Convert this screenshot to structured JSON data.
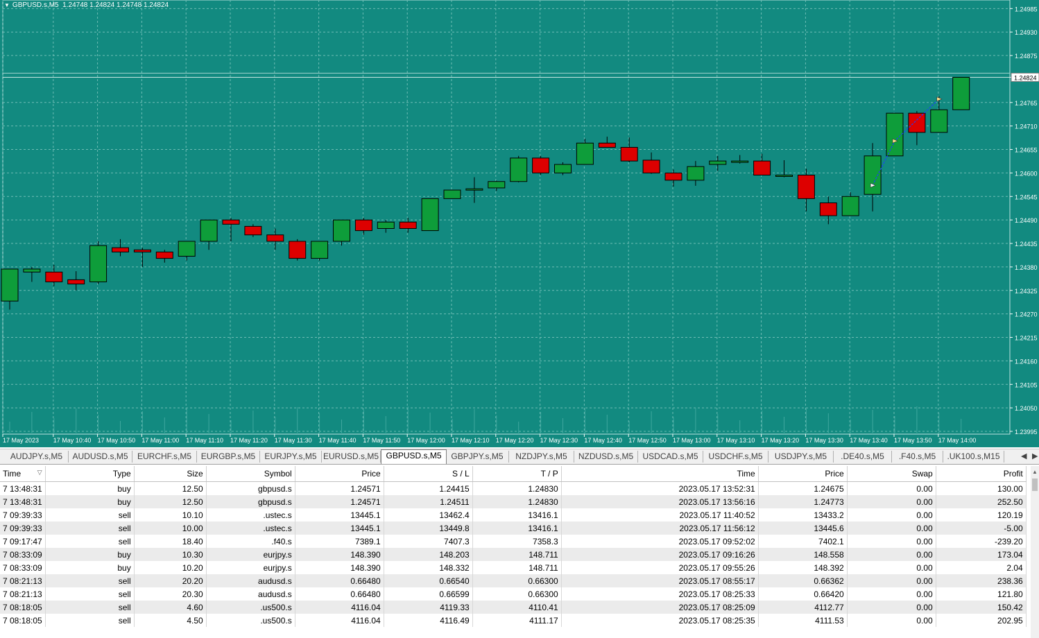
{
  "chart": {
    "symbol_header": "GBPUSD.s,M5",
    "ohlc_header": "1.24748 1.24824 1.24748 1.24824",
    "colors": {
      "background": "#128a80",
      "bull": "#0e9d3a",
      "bear": "#dd0000",
      "grid": "#6fbdb5",
      "text": "#ffffff"
    },
    "price_labels": [
      "1.24985",
      "1.24930",
      "1.24875",
      "1.24824",
      "1.24765",
      "1.24710",
      "1.24655",
      "1.24600",
      "1.24545",
      "1.24490",
      "1.24435",
      "1.24380",
      "1.24325",
      "1.24270",
      "1.24215",
      "1.24160",
      "1.24105",
      "1.24050",
      "1.23995"
    ],
    "current_price": "1.24824",
    "time_labels": [
      "17 May 2023",
      "17 May 10:40",
      "17 May 10:50",
      "17 May 11:00",
      "17 May 11:10",
      "17 May 11:20",
      "17 May 11:30",
      "17 May 11:40",
      "17 May 11:50",
      "17 May 12:00",
      "17 May 12:10",
      "17 May 12:20",
      "17 May 12:30",
      "17 May 12:40",
      "17 May 12:50",
      "17 May 13:00",
      "17 May 13:10",
      "17 May 13:20",
      "17 May 13:30",
      "17 May 13:40",
      "17 May 13:50",
      "17 May 14:00"
    ]
  },
  "chart_data": {
    "type": "candlestick",
    "ylim": [
      1.23995,
      1.25005
    ],
    "candles": [
      {
        "o": 1.243,
        "h": 1.2437,
        "l": 1.2428,
        "c": 1.24375
      },
      {
        "o": 1.24368,
        "h": 1.2438,
        "l": 1.24345,
        "c": 1.24375
      },
      {
        "o": 1.24368,
        "h": 1.24385,
        "l": 1.24335,
        "c": 1.24345
      },
      {
        "o": 1.2435,
        "h": 1.2437,
        "l": 1.24325,
        "c": 1.2434
      },
      {
        "o": 1.24345,
        "h": 1.2444,
        "l": 1.2434,
        "c": 1.2443
      },
      {
        "o": 1.24425,
        "h": 1.24445,
        "l": 1.24405,
        "c": 1.24415
      },
      {
        "o": 1.2442,
        "h": 1.24425,
        "l": 1.2438,
        "c": 1.24415
      },
      {
        "o": 1.24415,
        "h": 1.2442,
        "l": 1.2439,
        "c": 1.244
      },
      {
        "o": 1.24405,
        "h": 1.2444,
        "l": 1.24395,
        "c": 1.2444
      },
      {
        "o": 1.2444,
        "h": 1.2449,
        "l": 1.2442,
        "c": 1.2449
      },
      {
        "o": 1.2449,
        "h": 1.24495,
        "l": 1.2444,
        "c": 1.2448
      },
      {
        "o": 1.24475,
        "h": 1.2448,
        "l": 1.2445,
        "c": 1.24455
      },
      {
        "o": 1.24455,
        "h": 1.2447,
        "l": 1.2442,
        "c": 1.2444
      },
      {
        "o": 1.2444,
        "h": 1.24445,
        "l": 1.24395,
        "c": 1.244
      },
      {
        "o": 1.244,
        "h": 1.2444,
        "l": 1.24395,
        "c": 1.2444
      },
      {
        "o": 1.2444,
        "h": 1.2449,
        "l": 1.2443,
        "c": 1.2449
      },
      {
        "o": 1.2449,
        "h": 1.24495,
        "l": 1.24455,
        "c": 1.24465
      },
      {
        "o": 1.2447,
        "h": 1.2449,
        "l": 1.2446,
        "c": 1.24485
      },
      {
        "o": 1.24485,
        "h": 1.24495,
        "l": 1.2446,
        "c": 1.2447
      },
      {
        "o": 1.24465,
        "h": 1.24535,
        "l": 1.24465,
        "c": 1.2454
      },
      {
        "o": 1.2454,
        "h": 1.2456,
        "l": 1.2454,
        "c": 1.2456
      },
      {
        "o": 1.2456,
        "h": 1.2459,
        "l": 1.2453,
        "c": 1.24563
      },
      {
        "o": 1.24565,
        "h": 1.24582,
        "l": 1.24558,
        "c": 1.2458
      },
      {
        "o": 1.2458,
        "h": 1.2464,
        "l": 1.24578,
        "c": 1.24635
      },
      {
        "o": 1.24635,
        "h": 1.2464,
        "l": 1.24595,
        "c": 1.246
      },
      {
        "o": 1.246,
        "h": 1.24625,
        "l": 1.24595,
        "c": 1.2462
      },
      {
        "o": 1.2462,
        "h": 1.2468,
        "l": 1.2462,
        "c": 1.2467
      },
      {
        "o": 1.2467,
        "h": 1.24685,
        "l": 1.2466,
        "c": 1.2466
      },
      {
        "o": 1.2466,
        "h": 1.24683,
        "l": 1.24625,
        "c": 1.24628
      },
      {
        "o": 1.2463,
        "h": 1.24648,
        "l": 1.24598,
        "c": 1.246
      },
      {
        "o": 1.246,
        "h": 1.24608,
        "l": 1.24568,
        "c": 1.24583
      },
      {
        "o": 1.24583,
        "h": 1.24628,
        "l": 1.2457,
        "c": 1.24615
      },
      {
        "o": 1.2462,
        "h": 1.2464,
        "l": 1.24605,
        "c": 1.24628
      },
      {
        "o": 1.24628,
        "h": 1.24642,
        "l": 1.24622,
        "c": 1.24628
      },
      {
        "o": 1.24628,
        "h": 1.24645,
        "l": 1.246,
        "c": 1.24595
      },
      {
        "o": 1.24595,
        "h": 1.2463,
        "l": 1.2459,
        "c": 1.24595
      },
      {
        "o": 1.24595,
        "h": 1.2461,
        "l": 1.2451,
        "c": 1.2454
      },
      {
        "o": 1.2453,
        "h": 1.24545,
        "l": 1.2448,
        "c": 1.245
      },
      {
        "o": 1.245,
        "h": 1.24555,
        "l": 1.245,
        "c": 1.24545
      },
      {
        "o": 1.2455,
        "h": 1.2467,
        "l": 1.2451,
        "c": 1.2464
      },
      {
        "o": 1.2464,
        "h": 1.2474,
        "l": 1.2464,
        "c": 1.2474
      },
      {
        "o": 1.2474,
        "h": 1.24745,
        "l": 1.24665,
        "c": 1.24695
      },
      {
        "o": 1.24695,
        "h": 1.2478,
        "l": 1.24695,
        "c": 1.24748
      },
      {
        "o": 1.24748,
        "h": 1.24824,
        "l": 1.24748,
        "c": 1.24824
      }
    ],
    "trade_markers": [
      {
        "candle": 39,
        "price": 1.24571,
        "label": "open"
      },
      {
        "candle": 40,
        "price": 1.24675,
        "label": "close"
      },
      {
        "candle": 42,
        "price": 1.24773,
        "label": "close"
      }
    ]
  },
  "tabs": {
    "items": [
      "AUDJPY.s,M5",
      "AUDUSD.s,M5",
      "EURCHF.s,M5",
      "EURGBP.s,M5",
      "EURJPY.s,M5",
      "EURUSD.s,M5",
      "GBPUSD.s,M5",
      "GBPJPY.s,M5",
      "NZDJPY.s,M5",
      "NZDUSD.s,M5",
      "USDCAD.s,M5",
      "USDCHF.s,M5",
      "USDJPY.s,M5",
      ".DE40.s,M5",
      ".F40.s,M5",
      ".UK100.s,M15"
    ],
    "active_index": 6,
    "left_arrow": "◀",
    "right_arrow": "▶"
  },
  "history": {
    "columns": [
      "Time",
      "Type",
      "Size",
      "Symbol",
      "Price",
      "S / L",
      "T / P",
      "Time",
      "Price",
      "Swap",
      "Profit"
    ],
    "sort_indicator": "▽",
    "rows": [
      [
        "7 13:48:31",
        "buy",
        "12.50",
        "gbpusd.s",
        "1.24571",
        "1.24415",
        "1.24830",
        "2023.05.17 13:52:31",
        "1.24675",
        "0.00",
        "130.00"
      ],
      [
        "7 13:48:31",
        "buy",
        "12.50",
        "gbpusd.s",
        "1.24571",
        "1.24511",
        "1.24830",
        "2023.05.17 13:56:16",
        "1.24773",
        "0.00",
        "252.50"
      ],
      [
        "7 09:39:33",
        "sell",
        "10.10",
        ".ustec.s",
        "13445.1",
        "13462.4",
        "13416.1",
        "2023.05.17 11:40:52",
        "13433.2",
        "0.00",
        "120.19"
      ],
      [
        "7 09:39:33",
        "sell",
        "10.00",
        ".ustec.s",
        "13445.1",
        "13449.8",
        "13416.1",
        "2023.05.17 11:56:12",
        "13445.6",
        "0.00",
        "-5.00"
      ],
      [
        "7 09:17:47",
        "sell",
        "18.40",
        ".f40.s",
        "7389.1",
        "7407.3",
        "7358.3",
        "2023.05.17 09:52:02",
        "7402.1",
        "0.00",
        "-239.20"
      ],
      [
        "7 08:33:09",
        "buy",
        "10.30",
        "eurjpy.s",
        "148.390",
        "148.203",
        "148.711",
        "2023.05.17 09:16:26",
        "148.558",
        "0.00",
        "173.04"
      ],
      [
        "7 08:33:09",
        "buy",
        "10.20",
        "eurjpy.s",
        "148.390",
        "148.332",
        "148.711",
        "2023.05.17 09:55:26",
        "148.392",
        "0.00",
        "2.04"
      ],
      [
        "7 08:21:13",
        "sell",
        "20.20",
        "audusd.s",
        "0.66480",
        "0.66540",
        "0.66300",
        "2023.05.17 08:55:17",
        "0.66362",
        "0.00",
        "238.36"
      ],
      [
        "7 08:21:13",
        "sell",
        "20.30",
        "audusd.s",
        "0.66480",
        "0.66599",
        "0.66300",
        "2023.05.17 08:25:33",
        "0.66420",
        "0.00",
        "121.80"
      ],
      [
        "7 08:18:05",
        "sell",
        "4.60",
        ".us500.s",
        "4116.04",
        "4119.33",
        "4110.41",
        "2023.05.17 08:25:09",
        "4112.77",
        "0.00",
        "150.42"
      ],
      [
        "7 08:18:05",
        "sell",
        "4.50",
        ".us500.s",
        "4116.04",
        "4116.49",
        "4111.17",
        "2023.05.17 08:25:35",
        "4111.53",
        "0.00",
        "202.95"
      ]
    ]
  }
}
